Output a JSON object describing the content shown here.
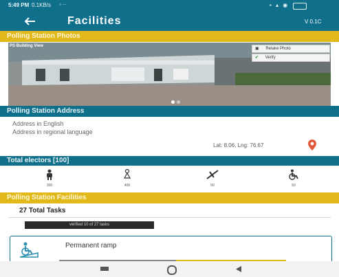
{
  "status_bar": {
    "time": "5:49 PM",
    "network_speed": "0.1KB/s"
  },
  "app_bar": {
    "back_icon": "back-arrow-icon",
    "title": "Facilities",
    "version": "V 0.1C"
  },
  "photos_section": {
    "header": "Polling Station Photos",
    "photo_label": "PS Building View",
    "retake_label": "Retake Photo",
    "verify_label": "Verify",
    "page_count": 2,
    "active_page": 1
  },
  "address_section": {
    "header": "Polling Station Address",
    "line1": "Address in English",
    "line2": "Address in regional language",
    "latlng": "Lat: 8.06, Lng: 76.67"
  },
  "electors": {
    "label": "Total electors [100]"
  },
  "amenities": [
    {
      "icon": "male-icon",
      "label": "300"
    },
    {
      "icon": "female-icon",
      "label": "400"
    },
    {
      "icon": "transgender-icon",
      "label": "50"
    },
    {
      "icon": "wheelchair-icon",
      "label": "50"
    }
  ],
  "facilities_section": {
    "header": "Polling Station Facilities",
    "total_tasks": "27 Total Tasks",
    "chip": "verified 10 of 27 tasks"
  },
  "facility_card": {
    "icon": "ramp-icon",
    "title": "Permanent ramp"
  },
  "colors": {
    "primary": "#10708c",
    "accent": "#e2b91b"
  }
}
